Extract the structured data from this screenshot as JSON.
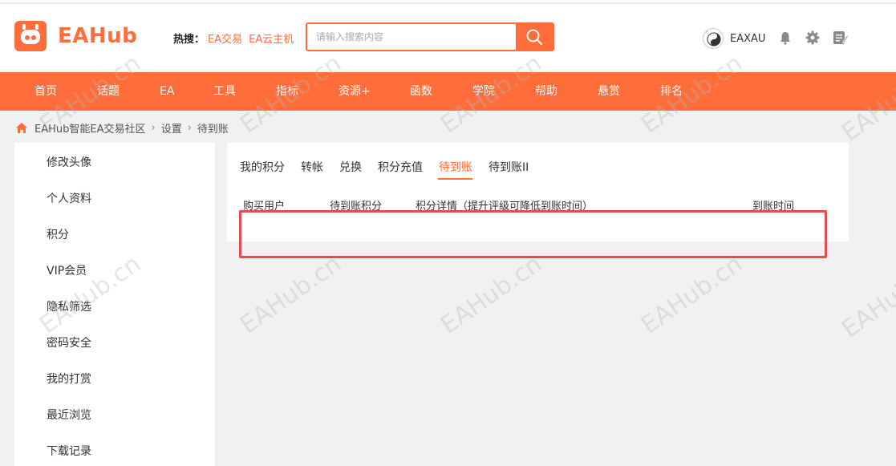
{
  "header": {
    "logo_text": "EAHub",
    "hot_label": "热搜：",
    "hot_links": [
      "EA交易",
      "EA云主机"
    ],
    "search_placeholder": "请输入搜索内容",
    "user_name": "EAXAU"
  },
  "nav": {
    "items": [
      "首页",
      "话题",
      "EA",
      "工具",
      "指标",
      "资源+",
      "函数",
      "学院",
      "帮助",
      "悬赏",
      "排名"
    ]
  },
  "breadcrumb": [
    "EAHub智能EA交易社区",
    "设置",
    "待到账"
  ],
  "sidebar": {
    "items": [
      "修改头像",
      "个人资料",
      "积分",
      "VIP会员",
      "隐私筛选",
      "密码安全",
      "我的打赏",
      "最近浏览",
      "下载记录"
    ]
  },
  "tabs": [
    "我的积分",
    "转帐",
    "兑换",
    "积分充值",
    "待到账",
    "待到账II"
  ],
  "active_tab": "待到账",
  "table": {
    "headers": [
      "购买用户",
      "待到账积分",
      "积分详情（提升评级可降低到账时间）",
      "到账时间"
    ]
  },
  "watermark": "EAHub.cn",
  "colors": {
    "accent": "#ff6d3b",
    "highlight_border": "#e84b50"
  }
}
